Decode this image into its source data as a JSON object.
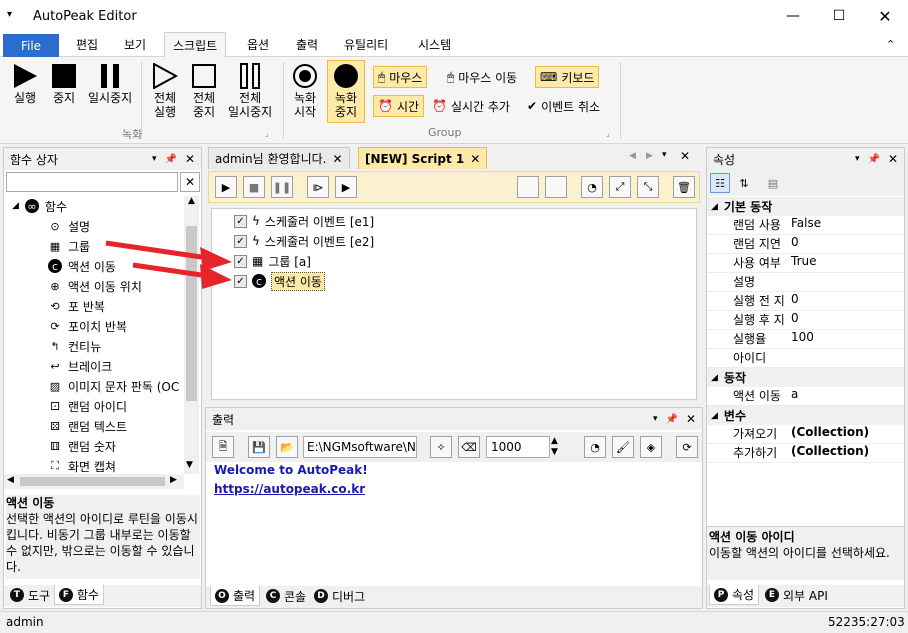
{
  "app": {
    "title": "AutoPeak Editor"
  },
  "ribbon_tabs": [
    "File",
    "편집",
    "보기",
    "스크립트",
    "옵션",
    "출력",
    "유틸리티",
    "시스템"
  ],
  "ribbon": {
    "run": "실행",
    "stop": "중지",
    "pause": "일시중지",
    "all_run": [
      "전체",
      "실행"
    ],
    "all_stop": [
      "전체",
      "중지"
    ],
    "all_pause": [
      "전체",
      "일시중지"
    ],
    "rec_start": [
      "녹화",
      "시작"
    ],
    "rec_stop": [
      "녹화",
      "중지"
    ],
    "group_record": "녹화",
    "group_group": "Group",
    "mouse": "마우스",
    "mouse_move": "마우스 이동",
    "keyboard": "키보드",
    "time": "시간",
    "realtime_add": "실시간 추가",
    "event_cancel": "이벤트 취소"
  },
  "left_panel": {
    "title": "함수 상자",
    "root": "함수",
    "items": [
      "설명",
      "그룹",
      "액션 이동",
      "액션 이동 위치",
      "포 반복",
      "포이치 반복",
      "컨티뉴",
      "브레이크",
      "이미지 문자 판독 (OC",
      "랜덤 아이디",
      "랜덤 텍스트",
      "랜덤 숫자",
      "화면 캡쳐"
    ],
    "desc_title": "액션 이동",
    "desc_text": "선택한 액션의 아이디로 루틴을 이동시킵니다. 비동기 그룹 내부로는 이동할 수 없지만, 밖으로는 이동할 수 있습니다.",
    "tabs": [
      "도구",
      "함수"
    ],
    "tab_keys": [
      "T",
      "F"
    ]
  },
  "doc_tabs": [
    "admin님 환영합니다.",
    "[NEW] Script 1"
  ],
  "events": [
    {
      "label": "스케줄러 이벤트 [e1]",
      "icon": "bolt-icon"
    },
    {
      "label": "스케줄러 이벤트 [e2]",
      "icon": "bolt-icon"
    },
    {
      "label": "그룹 [a]",
      "icon": "group-icon"
    },
    {
      "label": "액션 이동",
      "icon": "action-move-icon"
    }
  ],
  "output_panel": {
    "title": "출력",
    "path": "E:\\NGMsoftware\\NG",
    "count": "1000",
    "welcome": "Welcome to AutoPeak!",
    "link": "https://autopeak.co.kr",
    "tabs": [
      "출력",
      "콘솔",
      "디버그"
    ],
    "tab_keys": [
      "O",
      "C",
      "D"
    ]
  },
  "props_panel": {
    "title": "속성",
    "cat_basic": "기본 동작",
    "basic": [
      {
        "k": "랜덤 사용",
        "v": "False"
      },
      {
        "k": "랜덤 지연",
        "v": "0"
      },
      {
        "k": "사용 여부",
        "v": "True"
      },
      {
        "k": "설명",
        "v": ""
      },
      {
        "k": "실행 전 지",
        "v": "0"
      },
      {
        "k": "실행 후 지",
        "v": "0"
      },
      {
        "k": "실행율",
        "v": "100"
      },
      {
        "k": "아이디",
        "v": ""
      }
    ],
    "cat_action": "동작",
    "action": [
      {
        "k": "액션 이동",
        "v": "a"
      }
    ],
    "cat_var": "변수",
    "vars": [
      {
        "k": "가져오기",
        "v": "(Collection)"
      },
      {
        "k": "추가하기",
        "v": "(Collection)"
      }
    ],
    "desc_title": "액션 이동 아이디",
    "desc_text": "이동할 액션의 아이디를 선택하세요.",
    "tabs": [
      "속성",
      "외부 API"
    ],
    "tab_keys": [
      "P",
      "E"
    ]
  },
  "status": {
    "user": "admin",
    "time": "52235:27:03"
  },
  "colors": {
    "accent": "#2b6ccf",
    "highlight": "#fde9a8",
    "arrow": "#e8242b"
  }
}
